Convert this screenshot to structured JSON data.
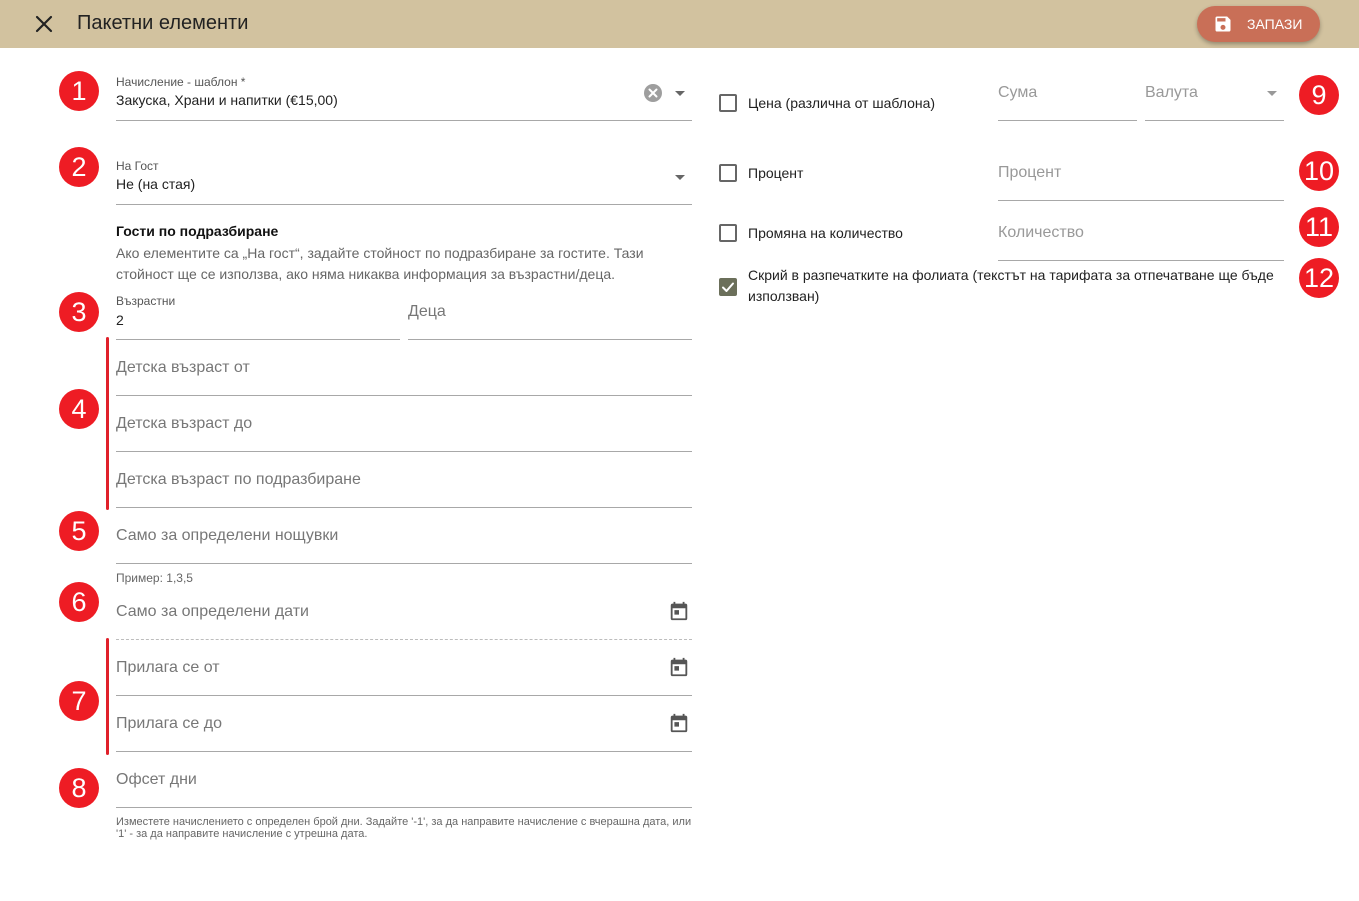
{
  "header": {
    "title": "Пакетни елементи",
    "save_label": "ЗАПАЗИ"
  },
  "badges": [
    "1",
    "2",
    "3",
    "4",
    "5",
    "6",
    "7",
    "8",
    "9",
    "10",
    "11",
    "12"
  ],
  "left": {
    "charge_template": {
      "label": "Начисление - шаблон *",
      "value": "Закуска, Храни и напитки (€15,00)"
    },
    "per_guest": {
      "label": "На Гост",
      "value": "Не (на стая)"
    },
    "default_guests": {
      "title": "Гости по подразбиране",
      "description": "Ако елементите са „На гост“, задайте стойност по подразбиране за гостите. Тази стойност ще се използва, ако няма никаква информация за възрастни/деца."
    },
    "adults": {
      "label": "Възрастни",
      "value": "2"
    },
    "children": {
      "placeholder": "Деца"
    },
    "child_age_from": {
      "placeholder": "Детска възраст от"
    },
    "child_age_to": {
      "placeholder": "Детска възраст до"
    },
    "child_age_default": {
      "placeholder": "Детска възраст по подразбиране"
    },
    "specific_nights": {
      "placeholder": "Само за определени нощувки",
      "hint": "Пример: 1,3,5"
    },
    "specific_dates": {
      "placeholder": "Само за определени дати"
    },
    "applies_from": {
      "placeholder": "Прилага се от"
    },
    "applies_to": {
      "placeholder": "Прилага се до"
    },
    "offset_days": {
      "placeholder": "Офсет дни",
      "hint": "Изместете начислението с определен брой дни. Задайте '-1', за да направите начисление с вчерашна дата, или '1' - за да направите начисление с утрешна дата."
    }
  },
  "right": {
    "price": {
      "label": "Цена (различна от шаблона)",
      "checked": false,
      "amount_placeholder": "Сума",
      "currency_placeholder": "Валута"
    },
    "percent": {
      "label": "Процент",
      "checked": false,
      "placeholder": "Процент"
    },
    "quantity": {
      "label": "Промяна на количество",
      "checked": false,
      "placeholder": "Количество"
    },
    "hide_print": {
      "label": "Скрий в разпечатките на фолиата (текстът на тарифата за отпечатване ще бъде използван)",
      "checked": true
    }
  },
  "colors": {
    "header_bg": "#d2c29f",
    "save_button": "#c96f57",
    "badge": "#ee1c24",
    "checkbox_checked": "#6b6f5a"
  },
  "icons": {
    "close": "close-icon",
    "save": "floppy-disk-icon",
    "clear": "clear-circle-icon",
    "dropdown": "caret-down-icon",
    "calendar": "calendar-icon",
    "check": "check-icon"
  }
}
